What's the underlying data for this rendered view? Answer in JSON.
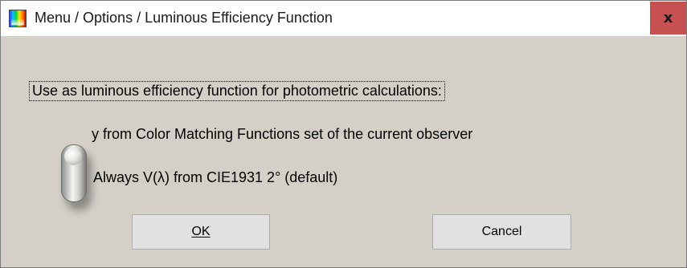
{
  "window": {
    "title": "Menu / Options / Luminous Efficiency Function",
    "app_icon": "spectrum-app-icon",
    "close_label": "x"
  },
  "dialog": {
    "question": "Use as luminous efficiency function for photometric calculations:",
    "options": [
      {
        "label": "y from Color Matching Functions set of the current observer"
      },
      {
        "label": "Always V(λ) from CIE1931 2° (default)"
      }
    ],
    "selected_option": "Always V(λ) from CIE1931 2° (default)"
  },
  "buttons": {
    "ok_label": "OK",
    "cancel_label": "Cancel"
  },
  "colors": {
    "background": "#d4d0c8",
    "titlebar": "#ffffff",
    "close_button": "#c75050",
    "button_face": "#e1e1e1"
  }
}
